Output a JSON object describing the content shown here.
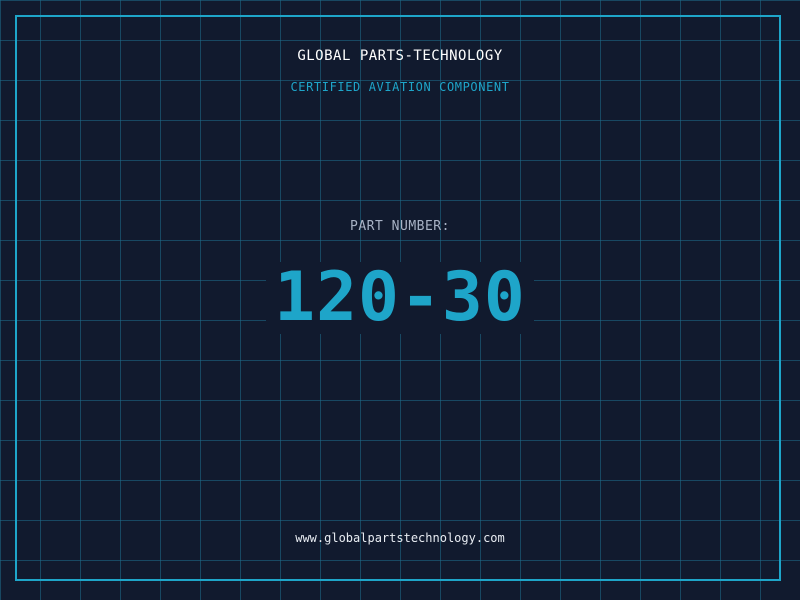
{
  "company_name": "GLOBAL PARTS-TECHNOLOGY",
  "subtitle": "CERTIFIED AVIATION COMPONENT",
  "part_number_label": "PART NUMBER:",
  "part_number": "120-30",
  "website": "www.globalpartstechnology.com",
  "colors": {
    "background": "#111a2e",
    "grid": "#1e6e8c",
    "accent": "#1ea5c9",
    "heading": "#ffffff",
    "label": "#a9b3c6"
  }
}
